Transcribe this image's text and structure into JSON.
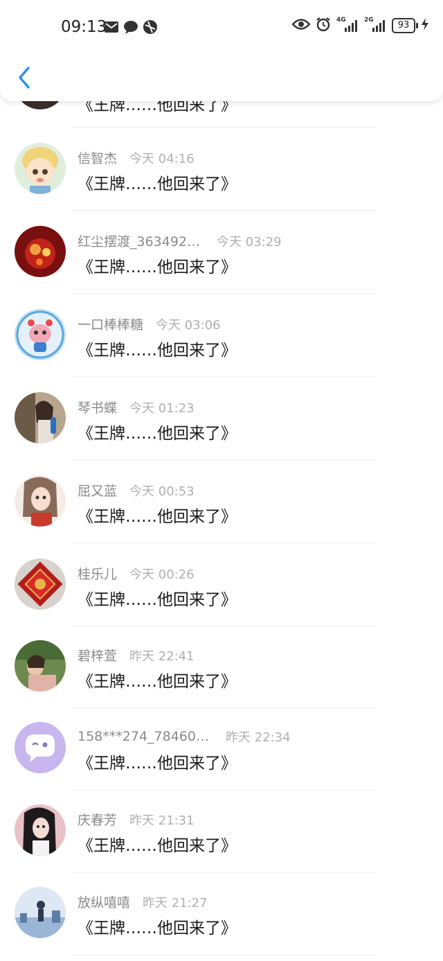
{
  "status_bar": {
    "time": "09:13",
    "battery": "93",
    "net1": "4G",
    "net2": "2G"
  },
  "header": {
    "back_icon": "chevron-left-icon",
    "accent": "#2b8fe8"
  },
  "messages": [
    {
      "name": "",
      "time": "",
      "text": "《王牌……他回来了》"
    },
    {
      "name": "信智杰",
      "time": "今天 04:16",
      "text": "《王牌……他回来了》"
    },
    {
      "name": "红尘摆渡_363492…",
      "time": "今天 03:29",
      "text": "《王牌……他回来了》"
    },
    {
      "name": "一口棒棒糖",
      "time": "今天 03:06",
      "text": "《王牌……他回来了》"
    },
    {
      "name": "琴书蝶",
      "time": "今天 01:23",
      "text": "《王牌……他回来了》"
    },
    {
      "name": "屈又蓝",
      "time": "今天 00:53",
      "text": "《王牌……他回来了》"
    },
    {
      "name": "桂乐儿",
      "time": "今天 00:26",
      "text": "《王牌……他回来了》"
    },
    {
      "name": "碧梓萱",
      "time": "昨天 22:41",
      "text": "《王牌……他回来了》"
    },
    {
      "name": "158***274_78460…",
      "time": "昨天 22:34",
      "text": "《王牌……他回来了》"
    },
    {
      "name": "庆春芳",
      "time": "昨天 21:31",
      "text": "《王牌……他回来了》"
    },
    {
      "name": "放纵嘻嘻",
      "time": "昨天 21:27",
      "text": "《王牌……他回来了》"
    }
  ]
}
